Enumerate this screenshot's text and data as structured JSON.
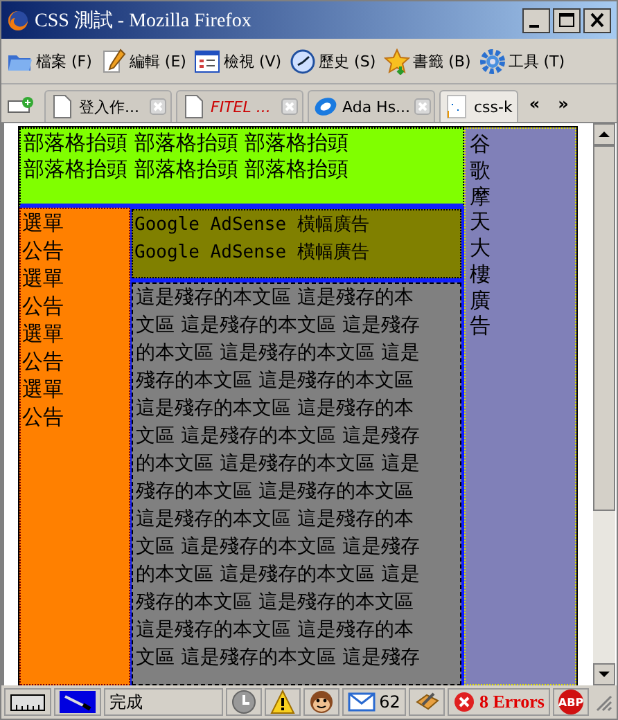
{
  "window": {
    "title": "CSS 測試 - Mozilla Firefox"
  },
  "menu": [
    {
      "label": "檔案",
      "accel": "(F)"
    },
    {
      "label": "編輯",
      "accel": "(E)"
    },
    {
      "label": "檢視",
      "accel": "(V)"
    },
    {
      "label": "歷史",
      "accel": "(S)"
    },
    {
      "label": "書籤",
      "accel": "(B)"
    },
    {
      "label": "工具",
      "accel": "(T)"
    }
  ],
  "tabs": [
    {
      "label": "登入作...",
      "selected": false,
      "kind": "normal"
    },
    {
      "label": "FITEL ...",
      "selected": false,
      "kind": "error"
    },
    {
      "label": "Ada Hs...",
      "selected": false,
      "kind": "normal"
    },
    {
      "label": "css-k",
      "selected": true,
      "kind": "normal"
    }
  ],
  "tab_scroll": {
    "left": "«",
    "right": "»"
  },
  "page": {
    "header": [
      "部落格抬頭 部落格抬頭 部落格抬頭",
      "部落格抬頭 部落格抬頭 部落格抬頭"
    ],
    "sidebar_items": [
      "選單",
      "公告",
      "選單",
      "公告",
      "選單",
      "公告",
      "選單",
      "公告"
    ],
    "banner": [
      "Google AdSense 橫幅廣告",
      "Google AdSense 橫幅廣告"
    ],
    "body_lines": [
      "這是殘存的本文區 這是殘存的本",
      "文區 這是殘存的本文區 這是殘存",
      "的本文區 這是殘存的本文區 這是",
      "殘存的本文區 這是殘存的本文區",
      "這是殘存的本文區 這是殘存的本",
      "文區 這是殘存的本文區 這是殘存",
      "的本文區 這是殘存的本文區 這是",
      "殘存的本文區 這是殘存的本文區",
      "這是殘存的本文區 這是殘存的本",
      "文區 這是殘存的本文區 這是殘存",
      "的本文區 這是殘存的本文區 這是",
      "殘存的本文區 這是殘存的本文區",
      "這是殘存的本文區 這是殘存的本",
      "文區 這是殘存的本文區 這是殘存"
    ],
    "skyscraper": "谷歌摩天大樓廣告"
  },
  "status_bar": {
    "status": "完成",
    "mail_count": "62",
    "errors": "8 Errors",
    "adblock": "ABP"
  }
}
